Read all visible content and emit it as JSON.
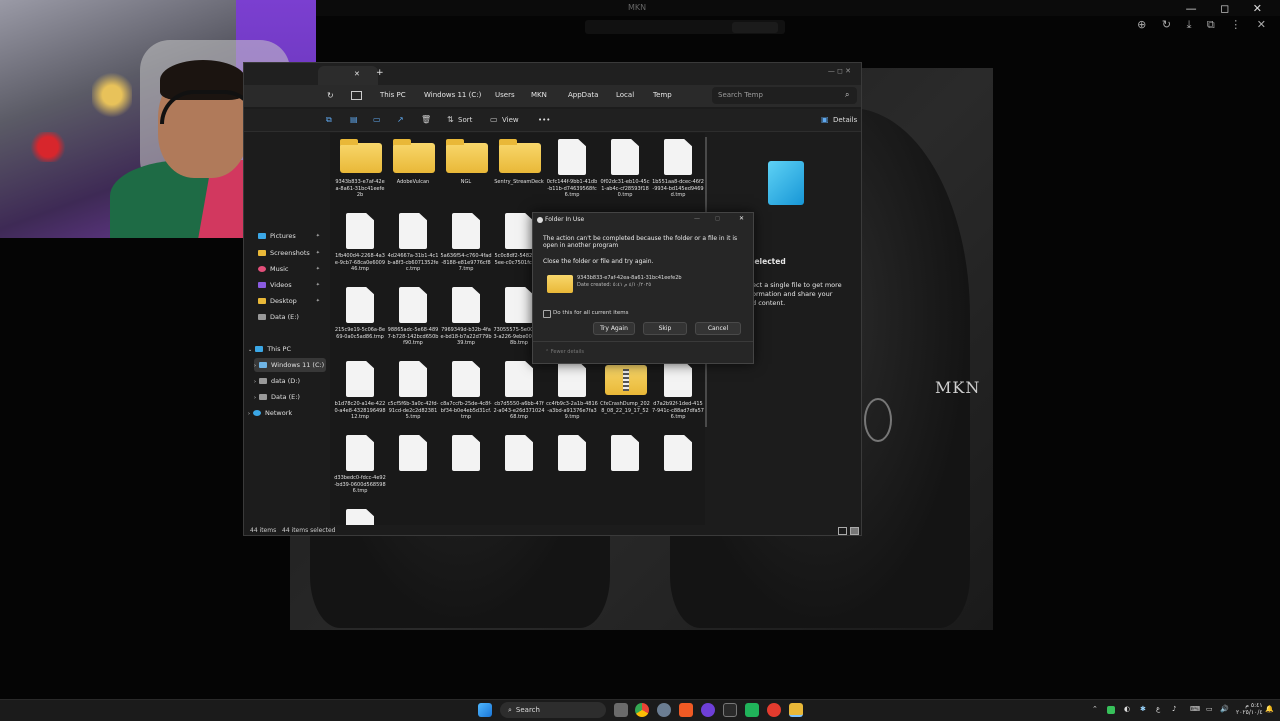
{
  "background_app": {
    "title": "MKN",
    "window_controls": "— ◻ ✕",
    "toolbar_icons": "⊕ ↻ ⤓ ⧉ ⋮ ✕"
  },
  "background_image": {
    "brand_text": "MKN"
  },
  "explorer": {
    "tab_close": "✕",
    "new_tab": "+",
    "window_controls": "—  ◻  ✕",
    "breadcrumb": [
      "This PC",
      "Windows 11 (C:)",
      "Users",
      "MKN",
      "AppData",
      "Local",
      "Temp"
    ],
    "search_placeholder": "Search Temp",
    "commands": {
      "sort": "Sort",
      "view": "View",
      "more": "•••",
      "details": "Details"
    },
    "sidebar": {
      "quick_access": [
        {
          "label": "Pictures"
        },
        {
          "label": "Screenshots"
        },
        {
          "label": "Music"
        },
        {
          "label": "Videos"
        },
        {
          "label": "Desktop"
        },
        {
          "label": "Data (E:)"
        }
      ],
      "this_pc": "This PC",
      "drives": [
        {
          "label": "Windows 11 (C:)"
        },
        {
          "label": "data (D:)"
        },
        {
          "label": "Data (E:)"
        }
      ],
      "network": "Network"
    },
    "files": [
      {
        "name": "9343b833-e7af-42ea-8a61-31bc41eefe2b",
        "type": "folder"
      },
      {
        "name": "AdobeVulcan",
        "type": "folder"
      },
      {
        "name": "NGL",
        "type": "folder"
      },
      {
        "name": "Sentry_StreamDeck",
        "type": "folder"
      },
      {
        "name": "0cfc144f-9bb1-41db-b11b-d74639568fc6.tmp",
        "type": "file"
      },
      {
        "name": "0f02dc31-eb10-45c1-ab4c-cf28593f180.tmp",
        "type": "file"
      },
      {
        "name": "1b551aa8-dcec-46f2-9934-bd145ed9469d.tmp",
        "type": "file"
      },
      {
        "name": "1fb400d4-2268-4a3e-9cb7-68ca0e600946.tmp",
        "type": "file"
      },
      {
        "name": "4d24667a-31b1-4c1b-a8f3-cb6071352fec.tmp",
        "type": "file"
      },
      {
        "name": "5a636f54-c760-4fad-8188-e81e9776cf87.tmp",
        "type": "file"
      },
      {
        "name": "5c0c8df2-5482be-95ee-c0c7501fc.tmp",
        "type": "file"
      },
      {
        "name": "9ea2c030-dc9b-4927-927d-a0004e8d9090.tmp",
        "type": "file"
      },
      {
        "name": "50adb1f1-222d-4771-a8f2-66de01a53108.tmp",
        "type": "file"
      },
      {
        "name": "78f0e871-32e0-407c-90e5-b5fd68b9c12d.tmp",
        "type": "file"
      },
      {
        "name": "215c9e19-5c06a-8e69-0a0c5ad86.tmp",
        "type": "file"
      },
      {
        "name": "98865adc-5e68-4897-b728-142bcd650bf90.tmp",
        "type": "file"
      },
      {
        "name": "7969349d-b32b-4fae-bd18-b7a22d779b39.tmp",
        "type": "file"
      },
      {
        "name": "73055575-5e00-47e3-a226-9ebe0062808b.tmp",
        "type": "file"
      },
      {
        "name": "a028fa19-f303-4927-99ff-b315421a6be0.tmp",
        "type": "file"
      },
      {
        "name": "a38b9346-159c-4a8f-9084-47e0d364ff01.tmp",
        "type": "file"
      },
      {
        "name": "adbad4c9-c126-41bf-b7d1-147c6f5cc1fc.tmp",
        "type": "file"
      },
      {
        "name": "b1d78c20-a14e-4220-a4e8-432819649812.tmp",
        "type": "file"
      },
      {
        "name": "c5cf5f6b-3a0c-42fd-91cd-de2c2d823815.tmp",
        "type": "file"
      },
      {
        "name": "c8a7ccfb-25de-4c8f-bf34-b0e4eb5d31cf.tmp",
        "type": "file"
      },
      {
        "name": "cb7d5550-a6bb-47f2-a043-e26d37102468.tmp",
        "type": "file"
      },
      {
        "name": "cc4fb9c3-2a1b-4816-a3bd-a91376e7fa39.tmp",
        "type": "file"
      },
      {
        "name": "CfxCrashDump_2028_08_22_19_17_52",
        "type": "zip"
      },
      {
        "name": "d7a2b92f-1ded-4157-941c-c88ad7dfa576.tmp",
        "type": "file"
      },
      {
        "name": "d33bedc0-fdcc-4e92-bd39-0600d5685986.tmp",
        "type": "file"
      },
      {
        "name": "",
        "type": "file"
      },
      {
        "name": "",
        "type": "file"
      },
      {
        "name": "",
        "type": "file"
      },
      {
        "name": "",
        "type": "file"
      },
      {
        "name": "",
        "type": "file"
      },
      {
        "name": "",
        "type": "file"
      },
      {
        "name": "",
        "type": "file"
      }
    ],
    "status": {
      "items": "44 items",
      "selected": "44 items selected"
    },
    "details_pane": {
      "heading": "selected",
      "message_lines": [
        "ect a single file to get more",
        "ormation and share your",
        "d content."
      ]
    }
  },
  "dialog": {
    "title": "Folder In Use",
    "message": "The action can't be completed because the folder or a file in it is open in another program",
    "instruction": "Close the folder or file and try again.",
    "folder_name": "9343b833-e7af-42ea-8a61-31bc41eefe2b",
    "date_created": "Date created: ٤/١٠/٢٠٢٥ م ٥:٤١",
    "checkbox_label": "Do this for all current items",
    "buttons": {
      "try_again": "Try Again",
      "skip": "Skip",
      "cancel": "Cancel"
    },
    "fewer_details": "Fewer details"
  },
  "taskbar": {
    "search_label": "Search",
    "clock_time": "٥:٤١ م",
    "clock_date": "٢٠٢٥/١٠/٤"
  }
}
